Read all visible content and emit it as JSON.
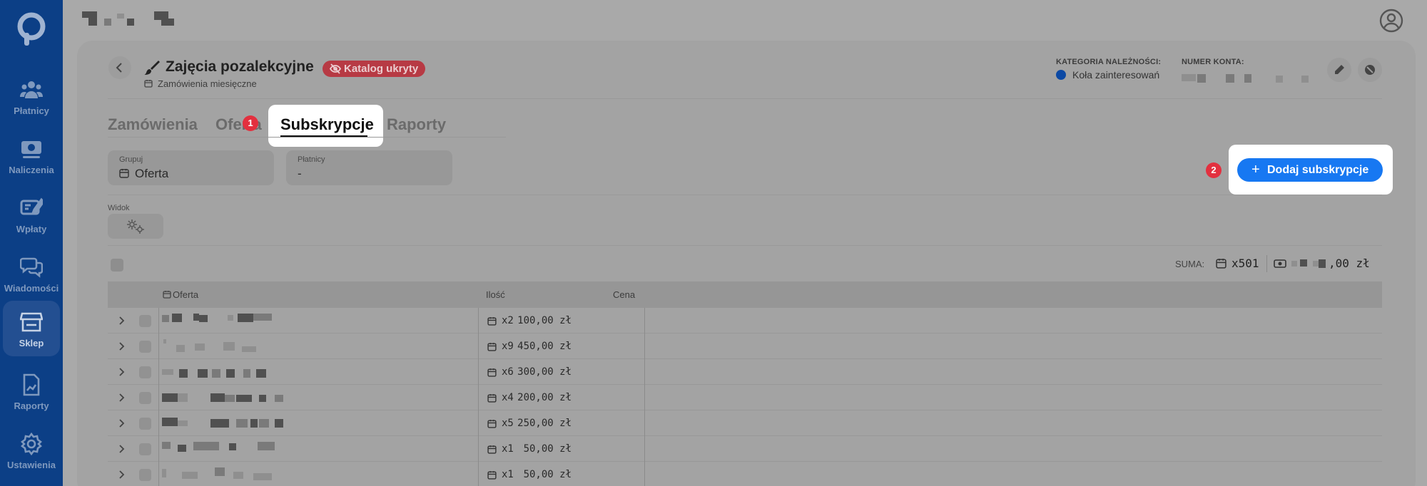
{
  "sidebar": {
    "items": [
      {
        "label": "Płatnicy",
        "icon": "users-icon"
      },
      {
        "label": "Naliczenia",
        "icon": "money-icon"
      },
      {
        "label": "Wpłaty",
        "icon": "payment-icon"
      },
      {
        "label": "Wiadomości",
        "icon": "chat-icon"
      },
      {
        "label": "Sklep",
        "icon": "store-icon",
        "active": true
      },
      {
        "label": "Raporty",
        "icon": "report-icon"
      },
      {
        "label": "Ustawienia",
        "icon": "gear-icon"
      }
    ]
  },
  "header": {
    "title": "Zajęcia pozalekcyjne",
    "badge": "Katalog ukryty",
    "subtitle": "Zamówienia miesięczne",
    "category_label": "KATEGORIA NALEŻNOŚCI:",
    "category_value": "Koła zainteresowań",
    "account_label": "NUMER KONTA:"
  },
  "tabs": {
    "orders": "Zamówienia",
    "offer": "Oferta",
    "subscriptions": "Subskrypcje",
    "reports": "Raporty"
  },
  "steps": {
    "one": "1",
    "two": "2"
  },
  "filters": {
    "group_label": "Grupuj",
    "group_value": "Oferta",
    "payers_label": "Płatnicy",
    "payers_value": "-"
  },
  "add_button": {
    "plus": "+",
    "label": "Dodaj subskrypcje"
  },
  "view": {
    "label": "Widok"
  },
  "summary": {
    "label": "SUMA:",
    "count": "x501",
    "amount_suffix": ",00 zł"
  },
  "table": {
    "columns": {
      "offer": "Oferta",
      "qty": "Ilość",
      "price": "Cena"
    },
    "rows": [
      {
        "qty": "x2",
        "price": "100,00 zł"
      },
      {
        "qty": "x9",
        "price": "450,00 zł"
      },
      {
        "qty": "x6",
        "price": "300,00 zł"
      },
      {
        "qty": "x4",
        "price": "200,00 zł"
      },
      {
        "qty": "x5",
        "price": "250,00 zł"
      },
      {
        "qty": "x1",
        "price": "50,00 zł"
      },
      {
        "qty": "x1",
        "price": "50,00 zł"
      }
    ]
  },
  "colors": {
    "sidebar": "#0c3f86",
    "accent": "#1778f2",
    "badge": "#e3303f"
  }
}
